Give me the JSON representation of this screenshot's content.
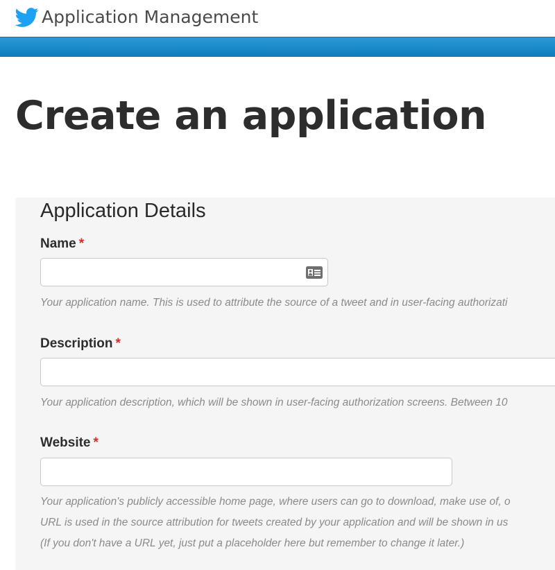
{
  "header": {
    "app_title": "Application Management",
    "logo_icon": "twitter-bird-icon",
    "brand_color": "#1da1f2",
    "bar_color": "#1a87c9"
  },
  "page": {
    "title": "Create an application"
  },
  "form": {
    "section_title": "Application Details",
    "required_marker": "*",
    "fields": [
      {
        "label": "Name",
        "value": "",
        "icon": "contact-card-icon",
        "help": "Your application name. This is used to attribute the source of a tweet and in user-facing authorizati"
      },
      {
        "label": "Description",
        "value": "",
        "help": "Your application description, which will be shown in user-facing authorization screens. Between 10"
      },
      {
        "label": "Website",
        "value": "",
        "help_lines": [
          "Your application's publicly accessible home page, where users can go to download, make use of, o",
          "URL is used in the source attribution for tweets created by your application and will be shown in us",
          "(If you don't have a URL yet, just put a placeholder here but remember to change it later.)"
        ]
      }
    ]
  }
}
